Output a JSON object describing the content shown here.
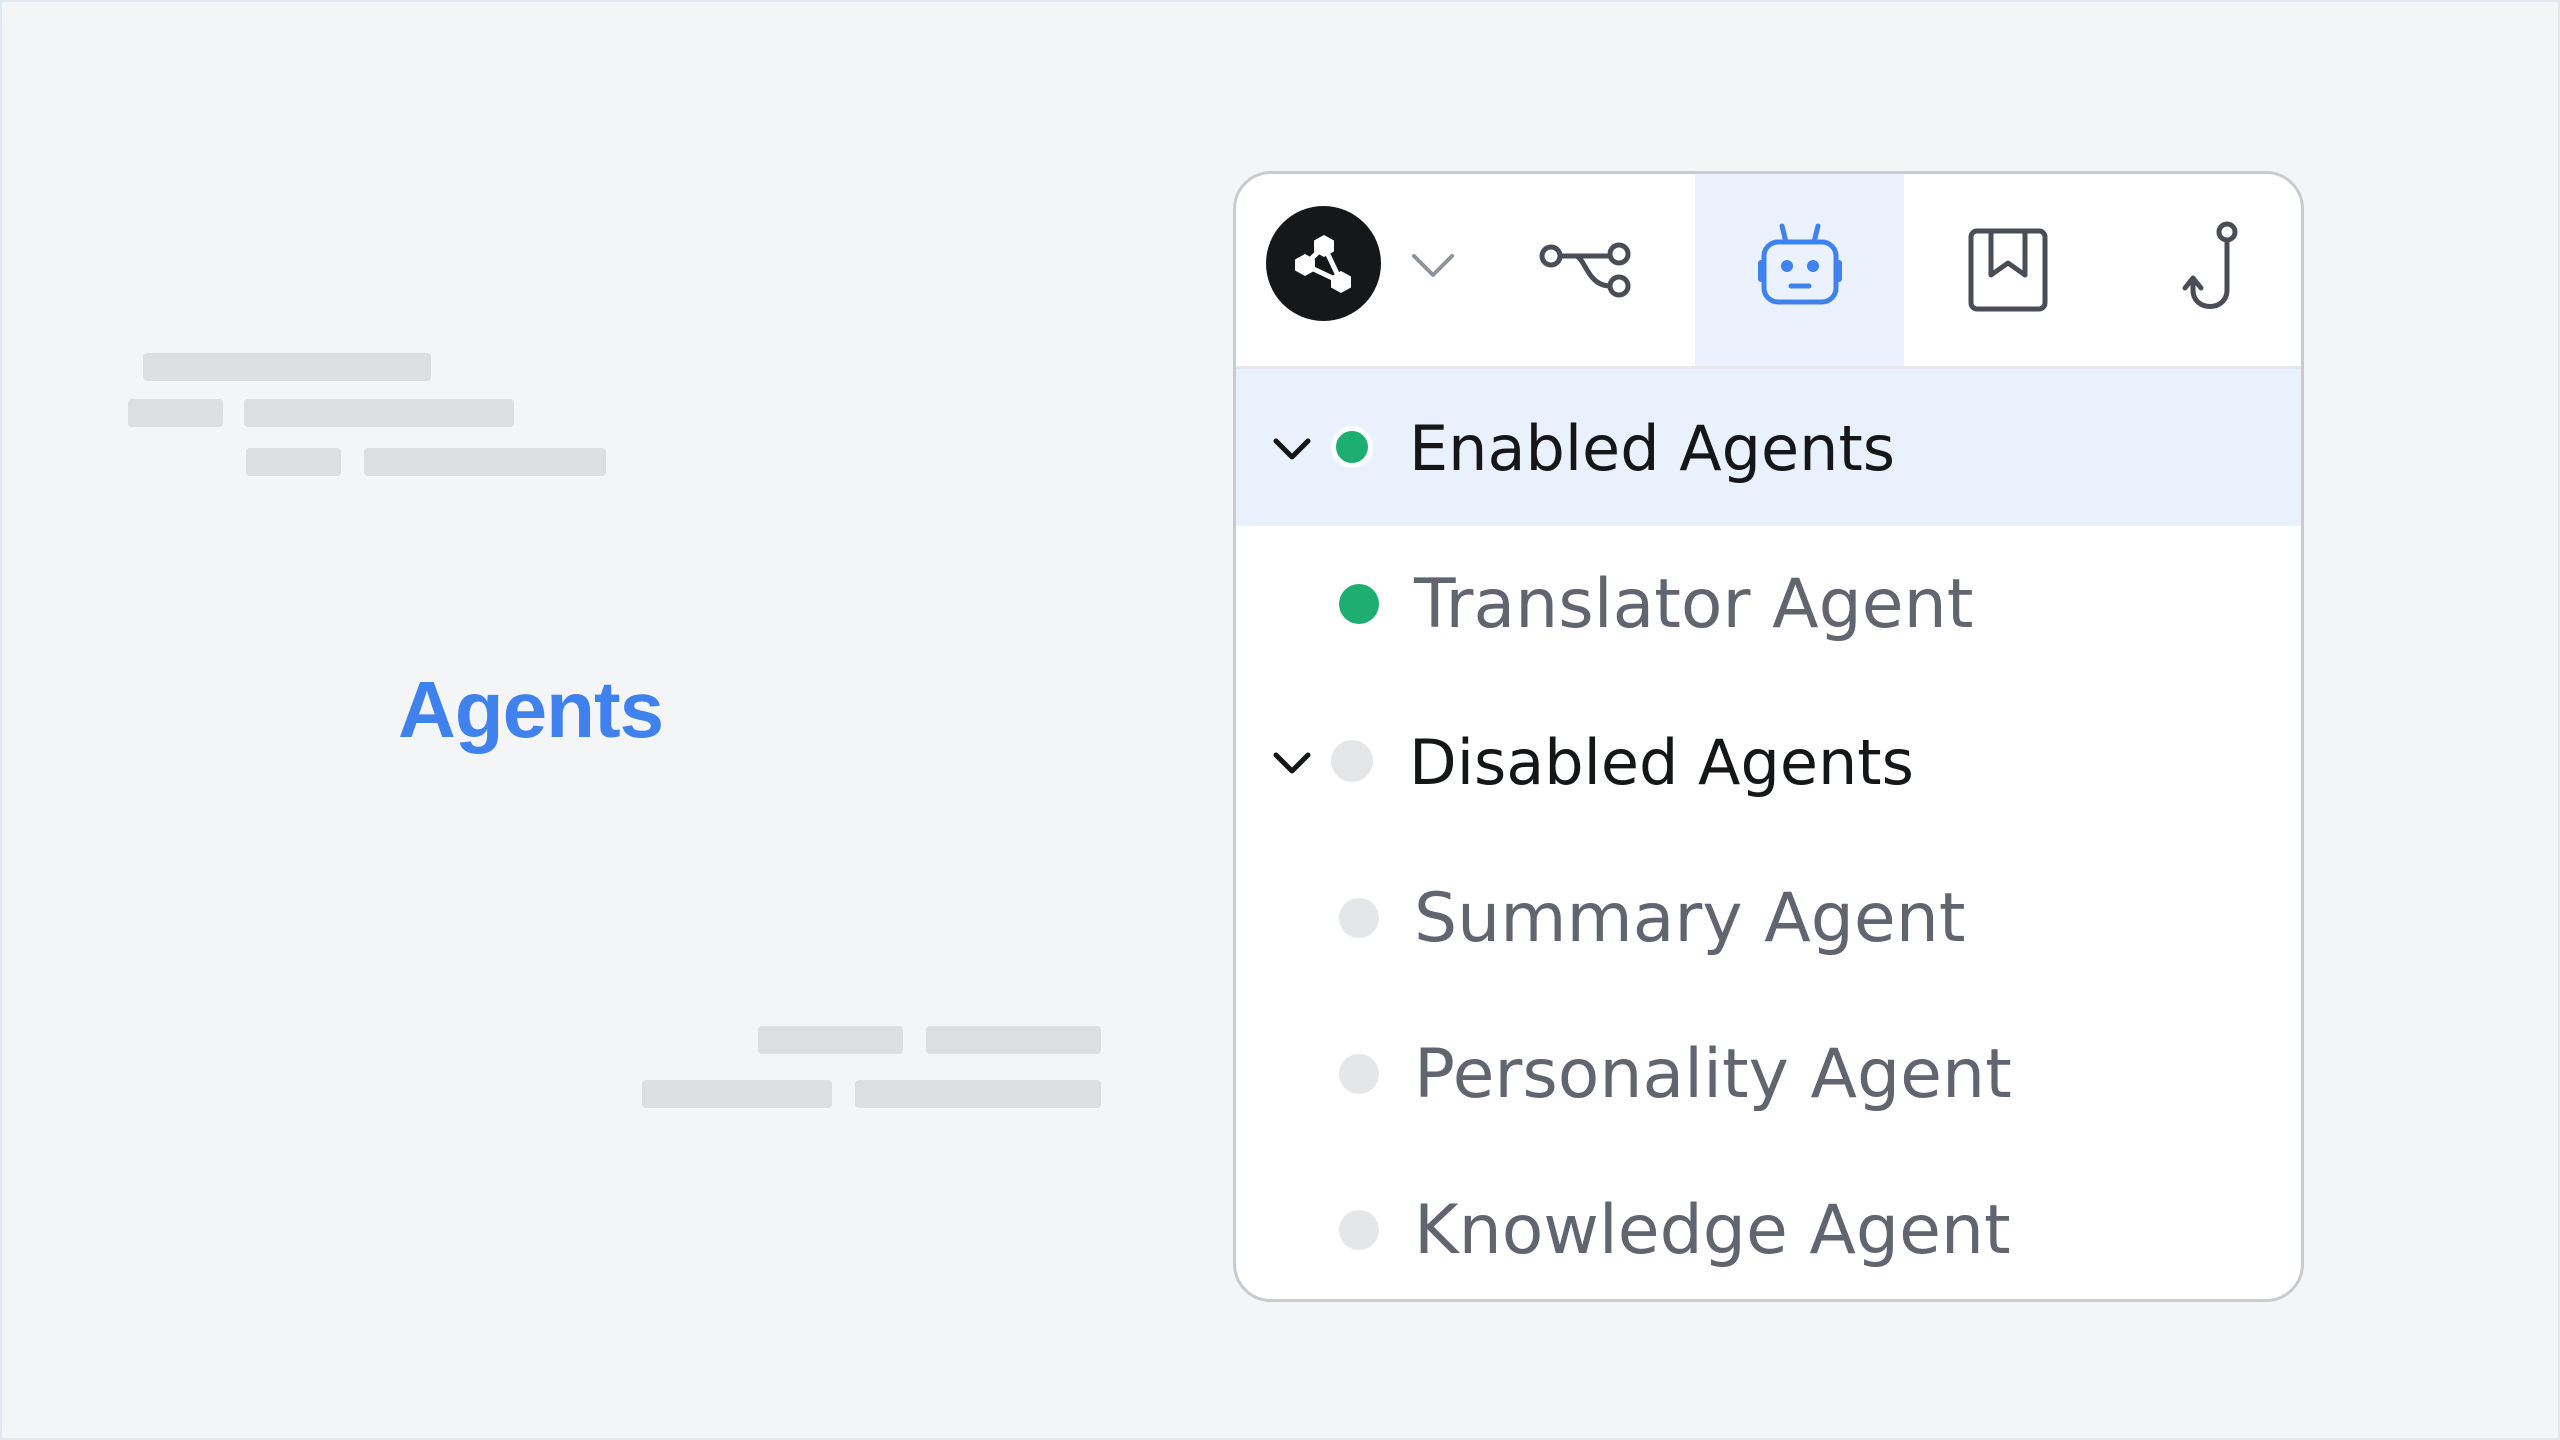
{
  "heading": "Agents",
  "toolbar": {
    "logo_icon": "share-nodes-icon",
    "menu_icon": "chevron-down-icon",
    "tools": [
      {
        "icon": "workflow-icon"
      },
      {
        "icon": "robot-icon",
        "active": true
      },
      {
        "icon": "bookmark-book-icon"
      },
      {
        "icon": "hook-icon"
      }
    ],
    "accent_color": "#3f82ee"
  },
  "agents": {
    "enabled_group": {
      "label": "Enabled Agents",
      "status_color": "#1fae71",
      "items": [
        {
          "label": "Translator Agent"
        }
      ]
    },
    "disabled_group": {
      "label": "Disabled Agents",
      "status_color": "#e5e6e8",
      "items": [
        {
          "label": "Summary Agent"
        },
        {
          "label": "Personality Agent"
        },
        {
          "label": "Knowledge Agent"
        }
      ]
    }
  }
}
